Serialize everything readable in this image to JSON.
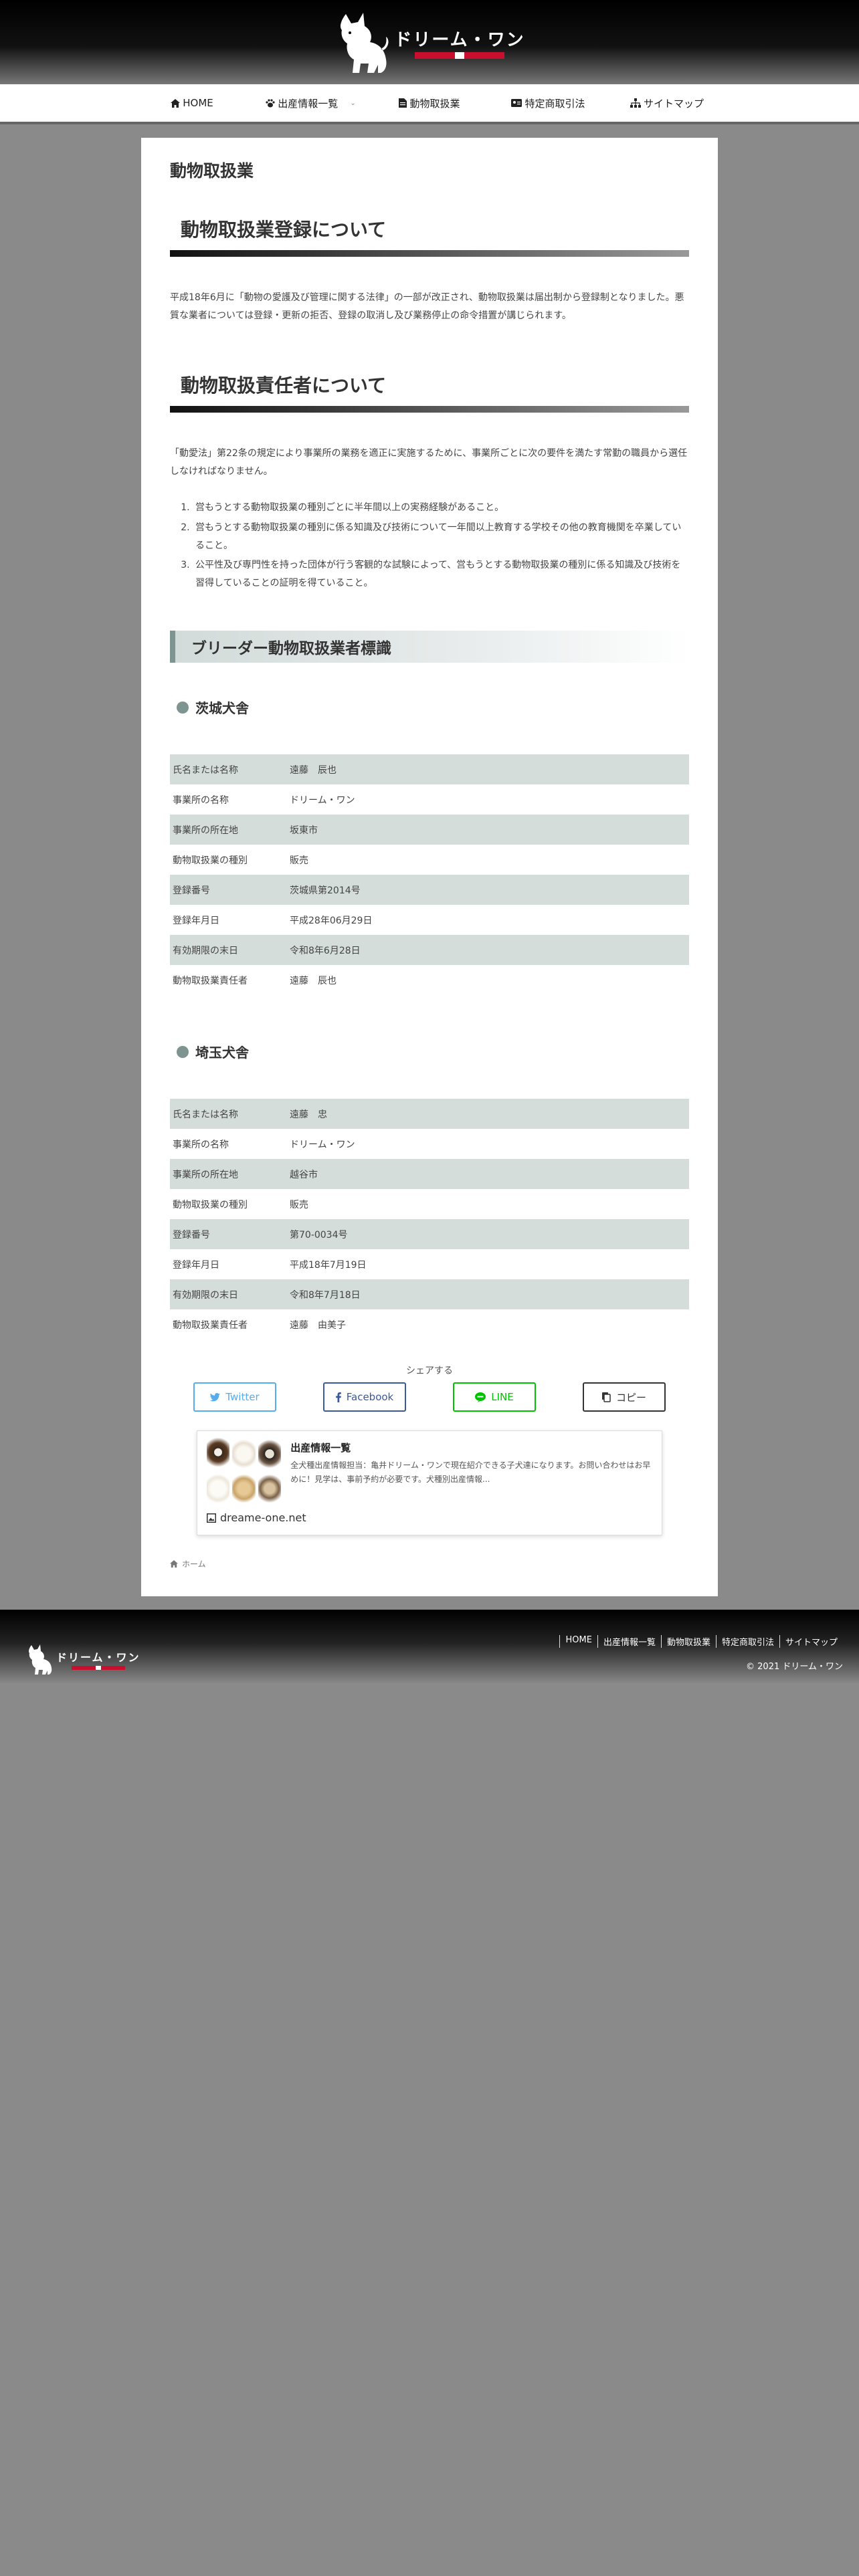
{
  "header": {
    "logo_text": "ドリーム・ワン"
  },
  "nav": [
    {
      "label": "HOME",
      "icon": "home-icon"
    },
    {
      "label": "出産情報一覧",
      "icon": "paw-icon",
      "has_dropdown": true
    },
    {
      "label": "動物取扱業",
      "icon": "document-icon"
    },
    {
      "label": "特定商取引法",
      "icon": "card-icon"
    },
    {
      "label": "サイトマップ",
      "icon": "sitemap-icon"
    }
  ],
  "page_title": "動物取扱業",
  "sections": {
    "registration": {
      "heading": "動物取扱業登録について",
      "text": "平成18年6月に「動物の愛護及び管理に関する法律」の一部が改正され、動物取扱業は届出制から登録制となりました。悪質な業者については登録・更新の拒否、登録の取消し及び業務停止の命令措置が講じられます。"
    },
    "responsible": {
      "heading": "動物取扱責任者について",
      "text": "「動愛法」第22条の規定により事業所の業務を適正に実施するために、事業所ごとに次の要件を満たす常勤の職員から選任しなければなりません。",
      "requirements": [
        "営もうとする動物取扱業の種別ごとに半年間以上の実務経験があること。",
        "営もうとする動物取扱業の種別に係る知識及び技術について一年間以上教育する学校その他の教育機関を卒業していること。",
        "公平性及び専門性を持った団体が行う客観的な試験によって、営もうとする動物取扱業の種別に係る知識及び技術を習得していることの証明を得ていること。"
      ]
    },
    "sign": {
      "heading": "ブリーダー動物取扱業者標識",
      "ibaraki": {
        "heading": "茨城犬舎",
        "rows": [
          {
            "k": "氏名または名称",
            "v": "遠藤　辰也"
          },
          {
            "k": "事業所の名称",
            "v": "ドリーム・ワン"
          },
          {
            "k": "事業所の所在地",
            "v": "坂東市"
          },
          {
            "k": "動物取扱業の種別",
            "v": "販売"
          },
          {
            "k": "登録番号",
            "v": "茨城県第2014号"
          },
          {
            "k": "登録年月日",
            "v": "平成28年06月29日"
          },
          {
            "k": "有効期限の末日",
            "v": "令和8年6月28日"
          },
          {
            "k": "動物取扱業責任者",
            "v": "遠藤　辰也"
          }
        ]
      },
      "saitama": {
        "heading": "埼玉犬舎",
        "rows": [
          {
            "k": "氏名または名称",
            "v": "遠藤　忠"
          },
          {
            "k": "事業所の名称",
            "v": "ドリーム・ワン"
          },
          {
            "k": "事業所の所在地",
            "v": "越谷市"
          },
          {
            "k": "動物取扱業の種別",
            "v": "販売"
          },
          {
            "k": "登録番号",
            "v": "第70-0034号"
          },
          {
            "k": "登録年月日",
            "v": "平成18年7月19日"
          },
          {
            "k": "有効期限の末日",
            "v": "令和8年7月18日"
          },
          {
            "k": "動物取扱業責任者",
            "v": "遠藤　由美子"
          }
        ]
      }
    }
  },
  "share": {
    "label": "シェアする",
    "twitter": "Twitter",
    "facebook": "Facebook",
    "line": "LINE",
    "copy": "コピー"
  },
  "link_card": {
    "title": "出産情報一覧",
    "desc": "全犬種出産情報担当：亀井ドリーム・ワンで現在紹介できる子犬達になります。お問い合わせはお早めに！見学は、事前予約が必要です。犬種別出産情報...",
    "site": "dreame-one.net"
  },
  "breadcrumb": {
    "home": "ホーム"
  },
  "footer": {
    "logo_text": "ドリーム・ワン",
    "nav": [
      "HOME",
      "出産情報一覧",
      "動物取扱業",
      "特定商取引法",
      "サイトマップ"
    ],
    "copyright": "© 2021 ドリーム・ワン"
  },
  "colors": {
    "accent": "#7d9490",
    "row_bg": "#d5dddb",
    "twitter": "#55acee",
    "facebook": "#3b5998",
    "line": "#00c300"
  }
}
